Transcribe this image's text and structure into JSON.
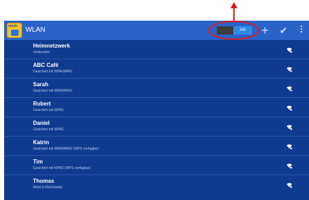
{
  "header": {
    "brand": "vtech",
    "title": "WLAN",
    "toggle_label": "AN",
    "add_icon": "plus-icon",
    "confirm_icon": "check-icon",
    "menu_icon": "overflow-menu-icon"
  },
  "networks": [
    {
      "name": "Heimnetzwerk",
      "status": "Verbunden"
    },
    {
      "name": "ABC Café",
      "status": "Gesichert mit WPA/WPA2"
    },
    {
      "name": "Sarah",
      "status": "Gesichert mit WPA/WPA2"
    },
    {
      "name": "Robert",
      "status": "Gesichert mit WPA2"
    },
    {
      "name": "Daniel",
      "status": "Gesichert mit WPA2"
    },
    {
      "name": "Katrin",
      "status": "Gesichert mit WPA/WPA2 (WPS verfügbar)"
    },
    {
      "name": "Tim",
      "status": "Gesichert mit WPA2 (WPS verfügbar)"
    },
    {
      "name": "Thomas",
      "status": "Nicht in Reichweite"
    }
  ],
  "colors": {
    "actionbar": "#2a63c8",
    "list_background": "#0f3b8f",
    "annotation": "#e01818"
  }
}
